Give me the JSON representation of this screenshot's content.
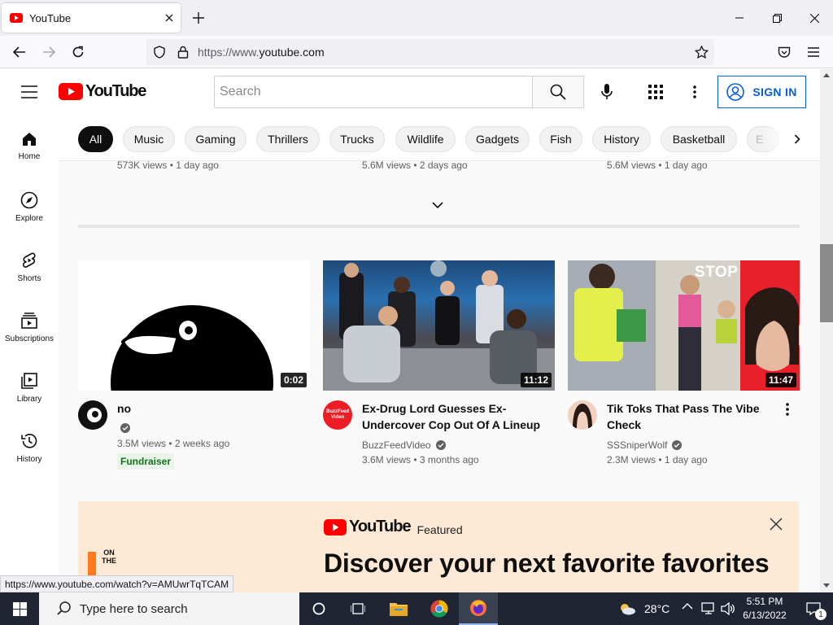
{
  "browser": {
    "tab_title": "YouTube",
    "url_prefix": "https://www.",
    "url_domain": "youtube.com",
    "status_url": "https://www.youtube.com/watch?v=AMUwrTqTCAM"
  },
  "youtube": {
    "logo_text": "YouTube",
    "search_placeholder": "Search",
    "sign_in": "SIGN IN"
  },
  "guide": [
    {
      "label": "Home",
      "icon": "home-icon"
    },
    {
      "label": "Explore",
      "icon": "compass-icon"
    },
    {
      "label": "Shorts",
      "icon": "shorts-icon"
    },
    {
      "label": "Subscriptions",
      "icon": "subscriptions-icon"
    },
    {
      "label": "Library",
      "icon": "library-icon"
    },
    {
      "label": "History",
      "icon": "history-icon"
    }
  ],
  "chips": [
    "All",
    "Music",
    "Gaming",
    "Thrillers",
    "Trucks",
    "Wildlife",
    "Gadgets",
    "Fish",
    "History",
    "Basketball",
    "E"
  ],
  "prev_row": [
    "573K views • 1 day ago",
    "5.6M views • 2 days ago",
    "5.6M views • 1 day ago"
  ],
  "videos": [
    {
      "title": "no",
      "channel": "",
      "views_age": "3.5M views • 2 weeks ago",
      "duration": "0:02",
      "badge": "Fundraiser"
    },
    {
      "title": "Ex-Drug Lord Guesses Ex-Undercover Cop Out Of A Lineup",
      "channel": "BuzzFeedVideo",
      "views_age": "3.6M views • 3 months ago",
      "duration": "11:12",
      "avatar_text": "BuzzFeed Video"
    },
    {
      "title": "Tik Toks That Pass The Vibe Check",
      "channel": "SSSniperWolf",
      "views_age": "2.3M views • 1 day ago",
      "duration": "11:47",
      "thumb_text": "STOP"
    }
  ],
  "banner": {
    "logo_text": "YouTube",
    "featured": "Featured",
    "headline": "Discover your next favorite favorites",
    "left_art_text": "ON THE"
  },
  "taskbar": {
    "search_placeholder": "Type here to search",
    "temperature": "28°C",
    "time": "5:51 PM",
    "date": "6/13/2022",
    "notification_count": "1"
  },
  "colors": {
    "youtube_red": "#ff0000",
    "link_blue": "#065fd4",
    "fundraiser_green": "#107516"
  }
}
